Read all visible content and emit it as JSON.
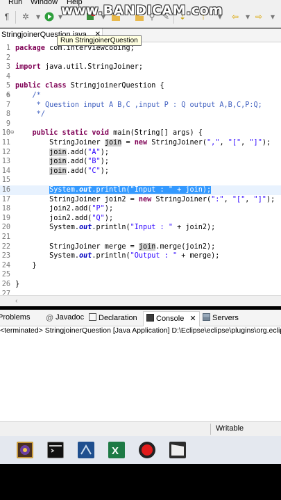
{
  "menu": [
    "Run",
    "Window",
    "Help"
  ],
  "watermark": "www.BANDICAM.com",
  "editor_tab": {
    "title": "StringjoinerQuestion.java",
    "close": "✕"
  },
  "tooltip": "Run StringjoinerQuestion",
  "code_lines": [
    {
      "n": "1",
      "fold": "",
      "html": "<span class=\"kw\">package</span> com.interviewcoding;"
    },
    {
      "n": "2",
      "fold": "",
      "html": ""
    },
    {
      "n": "3",
      "fold": "",
      "html": "<span class=\"kw\">import</span> java.util.StringJoiner;"
    },
    {
      "n": "4",
      "fold": "",
      "html": ""
    },
    {
      "n": "5",
      "fold": "",
      "html": "<span class=\"kw\">public class</span> StringjoinerQuestion {"
    },
    {
      "n": "6",
      "fold": "⊖",
      "html": "    <span class=\"cm\">/*</span>"
    },
    {
      "n": "7",
      "fold": "",
      "html": "    <span class=\"cm\"> * Question input A B,C ,input P : Q output A,B,C,P:Q;</span>"
    },
    {
      "n": "8",
      "fold": "",
      "html": "    <span class=\"cm\"> */</span>"
    },
    {
      "n": "9",
      "fold": "",
      "html": ""
    },
    {
      "n": "10",
      "fold": "⊖",
      "html": "    <span class=\"kw\">public static void</span> main(String[] args) {"
    },
    {
      "n": "11",
      "fold": "",
      "html": "        StringJoiner <span class=\"hl\">join</span> = <span class=\"kw\">new</span> StringJoiner(<span class=\"str\">\",\"</span>, <span class=\"str\">\"[\"</span>, <span class=\"str\">\"]\"</span>);"
    },
    {
      "n": "12",
      "fold": "",
      "html": "        <span class=\"hl\">join</span>.add(<span class=\"str\">\"A\"</span>);"
    },
    {
      "n": "13",
      "fold": "",
      "html": "        <span class=\"hl\">join</span>.add(<span class=\"str\">\"B\"</span>);"
    },
    {
      "n": "14",
      "fold": "",
      "html": "        <span class=\"hl\">join</span>.add(<span class=\"str\">\"C\"</span>);"
    },
    {
      "n": "15",
      "fold": "",
      "html": ""
    },
    {
      "n": "16",
      "fold": "",
      "current": true,
      "html": "        <span class=\"sel\">System.<span class=\"it\">out</span>.println(\"Input : \" + join);</span>"
    },
    {
      "n": "17",
      "fold": "",
      "html": "        StringJoiner join2 = <span class=\"kw\">new</span> StringJoiner(<span class=\"str\">\":\"</span>, <span class=\"str\">\"[\"</span>, <span class=\"str\">\"]\"</span>);"
    },
    {
      "n": "18",
      "fold": "",
      "html": "        join2.add(<span class=\"str\">\"P\"</span>);"
    },
    {
      "n": "19",
      "fold": "",
      "html": "        join2.add(<span class=\"str\">\"Q\"</span>);"
    },
    {
      "n": "20",
      "fold": "",
      "html": "        System.<span class=\"it\">out</span>.println(<span class=\"str\">\"Input : \"</span> + join2);"
    },
    {
      "n": "21",
      "fold": "",
      "html": ""
    },
    {
      "n": "22",
      "fold": "",
      "html": "        StringJoiner merge = <span class=\"hl\">join</span>.merge(join2);"
    },
    {
      "n": "23",
      "fold": "",
      "html": "        System.<span class=\"it\">out</span>.println(<span class=\"str\">\"Output : \"</span> + merge);"
    },
    {
      "n": "24",
      "fold": "",
      "html": "    }"
    },
    {
      "n": "25",
      "fold": "",
      "html": ""
    },
    {
      "n": "26",
      "fold": "",
      "html": "}"
    },
    {
      "n": "27",
      "fold": "",
      "html": ""
    }
  ],
  "views": {
    "problems": "Problems",
    "javadoc": "Javadoc",
    "declaration": "Declaration",
    "console": "Console",
    "servers": "Servers",
    "close": "✕"
  },
  "console_header": "<terminated> StringjoinerQuestion [Java Application] D:\\Eclipse\\eclipse\\plugins\\org.eclipse",
  "status": "Writable",
  "colors": {
    "keyword": "#7f0055",
    "string": "#2a00ff",
    "comment": "#3f5fbf",
    "selection": "#3399ff"
  }
}
